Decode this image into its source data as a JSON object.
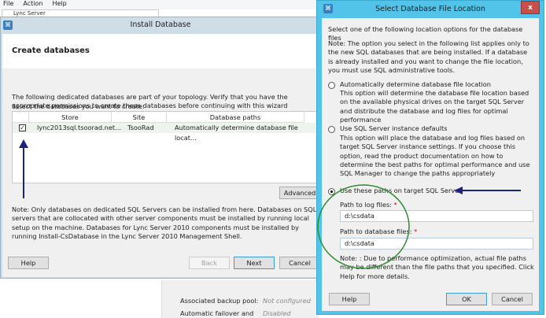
{
  "menu": [
    "File",
    "Action",
    "Help"
  ],
  "tree_item": "Lync Server",
  "install_window": {
    "title": "Install Database",
    "heading": "Create databases",
    "intro": "The following dedicated databases are part of your topology. Verify that you have the appropriate permissions to create these databases before continuing with this wizard",
    "select_label": "Select the databases you want to create:",
    "columns": [
      "Store",
      "Site",
      "Database paths"
    ],
    "rows": [
      {
        "checked": true,
        "store": "lync2013sql.tsoorad.net...",
        "site": "TsooRad",
        "paths": "Automatically determine database file locat..."
      }
    ],
    "advanced": "Advanced...",
    "note": "Note: Only databases on dedicated SQL Servers can be installed from here. Databases on SQL servers that are collocated with other server components must be installed by running local setup on the machine. Databases for Lync Server 2010 components must be installed by running Install-CsDatabase in the Lync Server 2010 Management Shell.",
    "buttons": {
      "help": "Help",
      "back": "Back",
      "next": "Next",
      "cancel": "Cancel"
    }
  },
  "background": {
    "rows": [
      {
        "label": "Associated backup pool:",
        "value": "Not configured"
      },
      {
        "label": "Automatic failover and",
        "value": "Disabled"
      }
    ]
  },
  "location_dialog": {
    "title": "Select Database File Location",
    "close": "x",
    "intro": "Select one of the following location options for the database files",
    "note": "Note: The option you select in the following list applies only to the new SQL databases that are being installed. If a database is already installed and you want to change the file location, you must use SQL administrative tools.",
    "options": [
      {
        "label": "Automatically determine database file location",
        "desc": "This option will determine the database file location based on the available physical drives on the target SQL Server and distribute the database and log files for optimal performance",
        "selected": false
      },
      {
        "label": "Use SQL Server instance defaults",
        "desc": "This option will place the database and log files based on target SQL Server instance settings. If you choose this option, read the product documentation on how to determine the best paths for optimal performance and use SQL Manager to change the paths appropriately",
        "selected": false
      },
      {
        "label": "Use these paths on target SQL Server",
        "selected": true
      }
    ],
    "log_label": "Path to log files:",
    "log_value": "d:\\csdata",
    "db_label": "Path to database files:",
    "db_value": "d:\\csdata",
    "required_mark": "*",
    "footer_note": "Note: : Due to performance optimization, actual file paths may be different than the file paths that you specified. Click Help for more details.",
    "buttons": {
      "help": "Help",
      "ok": "OK",
      "cancel": "Cancel"
    }
  },
  "colors": {
    "accent": "#52c4ea",
    "annotation_arrow": "#1a237e",
    "annotation_circle": "#2e8b2e"
  }
}
